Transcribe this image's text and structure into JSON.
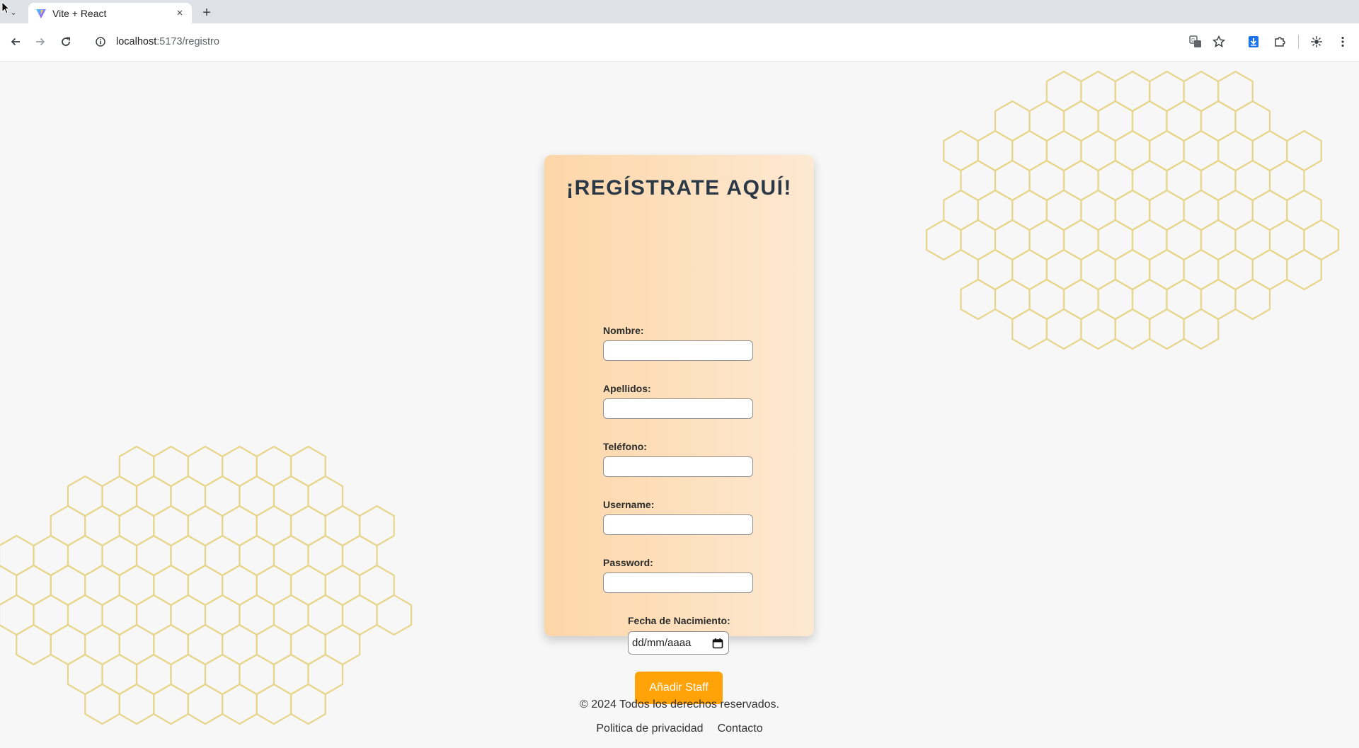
{
  "browser": {
    "tab_title": "Vite + React",
    "tab_close": "×",
    "new_tab": "+",
    "tab_menu": "⌄",
    "url_host": "localhost",
    "url_path": ":5173/registro"
  },
  "form": {
    "title": "¡REGÍSTRATE AQUÍ!",
    "fields": [
      {
        "label": "Nombre:",
        "value": ""
      },
      {
        "label": "Apellidos:",
        "value": ""
      },
      {
        "label": "Teléfono:",
        "value": ""
      },
      {
        "label": "Username:",
        "value": ""
      },
      {
        "label": "Password:",
        "value": ""
      }
    ],
    "date_label": "Fecha de Nacimiento:",
    "date_placeholder": "dd/mm/aaaa",
    "submit_label": "Añadir Staff"
  },
  "footer": {
    "copyright": "© 2024 Todos los derechos reservados.",
    "links": [
      "Politica de privacidad",
      "Contacto"
    ]
  },
  "colors": {
    "accent": "#ffa309",
    "card_gradient_start": "#fdd6a8",
    "card_gradient_end": "#fde9d2",
    "title": "#2b3947",
    "honeycomb": "#e6d58a",
    "background": "#f7f7f7"
  },
  "icons": {
    "back": "arrow-left-icon",
    "forward": "arrow-right-icon",
    "reload": "reload-icon",
    "site_info": "info-icon",
    "translate": "translate-icon",
    "bookmark": "star-icon",
    "download": "download-icon",
    "extensions": "puzzle-icon",
    "profile": "profile-icon",
    "menu": "kebab-menu-icon",
    "calendar": "calendar-icon"
  }
}
